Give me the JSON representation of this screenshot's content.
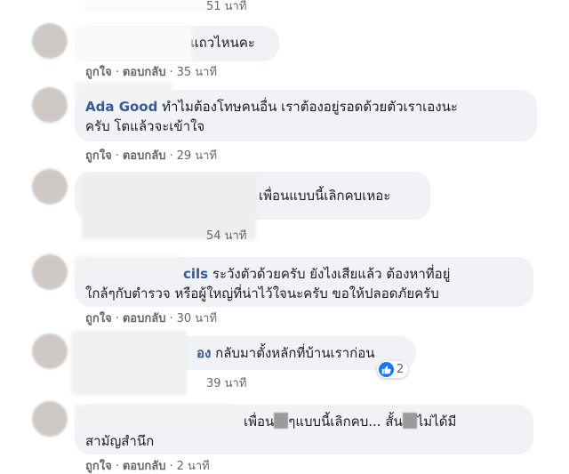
{
  "top": {
    "time": "51 นาที"
  },
  "actions": {
    "like": "ถูกใจ",
    "reply": "ตอบกลับ",
    "sep": "·"
  },
  "comments": [
    {
      "name": "",
      "text": "แถวไหนคะ",
      "time": "35 นาที"
    },
    {
      "name": "Ada Good",
      "line1": "ทำไมต้องโทษคนอื่น เราต้องอยู่รอดด้วยตัวเราเองนะ",
      "line2": "ครับ โตแล้วจะเข้าใจ",
      "time": "29 นาที"
    },
    {
      "name": "",
      "text": "เพื่อนแบบนี้เลิกคบเหอะ",
      "time": "54 นาที"
    },
    {
      "name": "cils",
      "line1": "ระวังตัวด้วยครับ ยังไงเสียแล้ว ต้องหาที่อยู่",
      "line2": "ใกล้ๆกับตำรวจ หรือผู้ใหญ่ที่น่าไว้ใจนะครับ ขอให้ปลอดภัยครับ",
      "time": "30 นาที"
    },
    {
      "name": "อง",
      "text": "กลับมาตั้งหลักที่บ้านเราก่อน",
      "time": "39 นาที",
      "reactions": "2"
    },
    {
      "name": "",
      "line1a": "เพื่อน",
      "line1b": "ๆแบบนี้เลิกคบ... สั้น",
      "line1c": "ไม่ได้มี",
      "line2": "สามัญสำนึก",
      "time": "2 นาที"
    }
  ],
  "colors": {
    "bubble": "#f0f2f5",
    "name": "#385898",
    "meta": "#65676b",
    "like": "#1877f2"
  }
}
